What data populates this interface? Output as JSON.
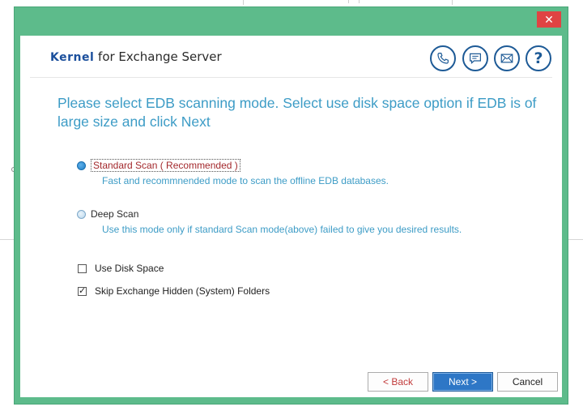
{
  "window": {
    "close_label": "✕"
  },
  "header": {
    "brand_logo": "Kernel",
    "brand_rest": " for Exchange Server",
    "icons": [
      "phone-icon",
      "chat-icon",
      "email-icon",
      "help-icon"
    ],
    "help_label": "?"
  },
  "instruction": "Please select EDB scanning mode. Select use disk space option if EDB is of large size and click Next",
  "scan_options": [
    {
      "label": "Standard Scan ( Recommended )",
      "description": "Fast and recommnended mode to scan the offline EDB databases.",
      "selected": true
    },
    {
      "label": "Deep Scan",
      "description": "Use this mode only if standard Scan mode(above) failed to give you desired results.",
      "selected": false
    }
  ],
  "options": [
    {
      "label": "Use Disk Space",
      "checked": false
    },
    {
      "label": "Skip Exchange Hidden (System) Folders",
      "checked": true
    }
  ],
  "buttons": {
    "back": "< Back",
    "next": "Next >",
    "cancel": "Cancel"
  },
  "colors": {
    "frame": "#5dbb8b",
    "accent": "#3d9cc6",
    "brand": "#1b4f9c",
    "primary_button": "#2e77c6",
    "close": "#e04343"
  }
}
